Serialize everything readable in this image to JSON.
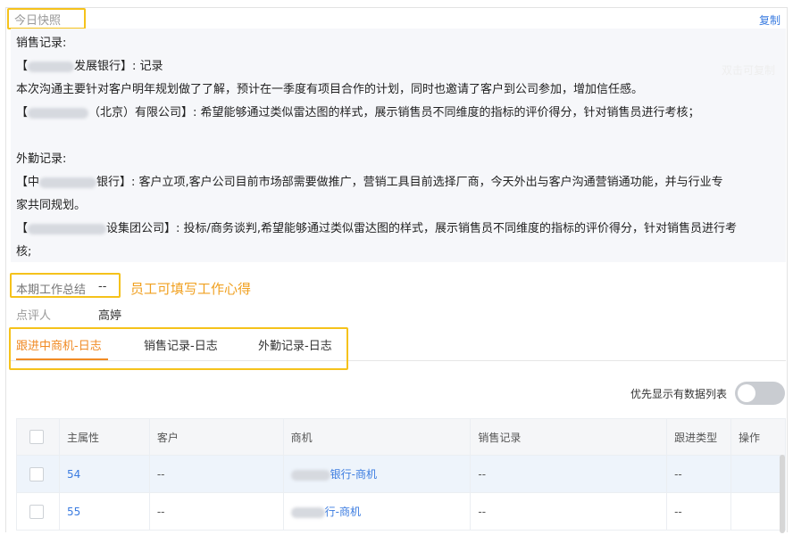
{
  "snapshot": {
    "title": "今日快照",
    "copy_label": "复制",
    "watermark": "双击可复制",
    "sales_heading": "销售记录:",
    "lines": [
      {
        "pre": "【",
        "post": "发展银行】: 记录"
      },
      {
        "text": "本次沟通主要针对客户明年规划做了了解，预计在一季度有项目合作的计划，同时也邀请了客户到公司参加，增加信任感。"
      },
      {
        "pre": "【",
        "post": "（北京）有限公司】: 希望能够通过类似雷达图的样式，展示销售员不同维度的指标的评价得分，针对销售员进行考核；"
      }
    ],
    "field_heading": "外勤记录:",
    "field_lines": [
      {
        "pre": "【中",
        "post": "银行】: 客户立项,客户公司目前市场部需要做推广，营销工具目前选择厂商，今天外出与客户沟通营销通功能，并与行业专"
      },
      {
        "text": "家共同规划。"
      },
      {
        "pre": "【",
        "post": "设集团公司】: 投标/商务谈判,希望能够通过类似雷达图的样式，展示销售员不同维度的指标的评价得分，针对销售员进行考"
      },
      {
        "text": "核;"
      }
    ]
  },
  "summary": {
    "label": "本期工作总结",
    "value": "--",
    "hint": "员工可填写工作心得"
  },
  "reviewer": {
    "label": "点评人",
    "value": "高婷"
  },
  "tabs": [
    {
      "label": "跟进中商机-日志",
      "active": true
    },
    {
      "label": "销售记录-日志",
      "active": false
    },
    {
      "label": "外勤记录-日志",
      "active": false
    }
  ],
  "toggle": {
    "label": "优先显示有数据列表",
    "on": false
  },
  "table": {
    "headers": [
      "主属性",
      "客户",
      "商机",
      "销售记录",
      "跟进类型",
      "操作"
    ],
    "rows": [
      {
        "id": "54",
        "customer": "--",
        "opportunity_suffix": "银行-商机",
        "sales": "--",
        "type": "--"
      },
      {
        "id": "55",
        "customer": "--",
        "opportunity_suffix": "行-商机",
        "sales": "--",
        "type": "--"
      }
    ]
  },
  "colors": {
    "accent": "#f08a24",
    "link": "#3a7be0",
    "highlight": "#f5c21b"
  }
}
